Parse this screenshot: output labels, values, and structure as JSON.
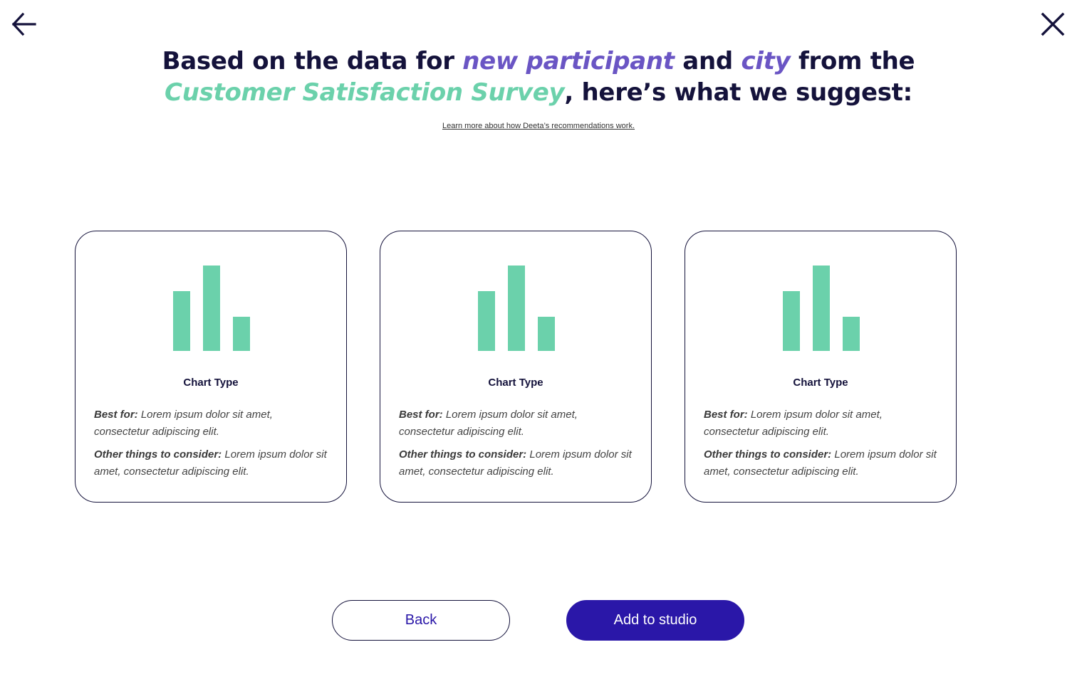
{
  "nav": {
    "back_icon": "arrow-left-icon",
    "close_icon": "close-icon"
  },
  "headline": {
    "part1": "Based on the data for ",
    "highlight1": "new participant",
    "part2": " and ",
    "highlight2": "city",
    "part3": " from the",
    "highlight3": "Customer Satisfaction Survey",
    "part4": ", here’s what we suggest:"
  },
  "learn_more": "Learn more about how Deeta’s recommendations work.",
  "cards": [
    {
      "title": "Chart Type",
      "best_label": "Best for:",
      "best_text": " Lorem ipsum dolor sit amet, consectetur adipiscing elit.",
      "other_label": "Other things to consider:",
      "other_text": " Lorem ipsum dolor sit amet, consectetur adipiscing elit."
    },
    {
      "title": "Chart Type",
      "best_label": "Best for:",
      "best_text": " Lorem ipsum dolor sit amet, consectetur adipiscing elit.",
      "other_label": "Other things to consider:",
      "other_text": " Lorem ipsum dolor sit amet, consectetur adipiscing elit."
    },
    {
      "title": "Chart Type",
      "best_label": "Best for:",
      "best_text": " Lorem ipsum dolor sit amet, consectetur adipiscing elit.",
      "other_label": "Other things to consider:",
      "other_text": " Lorem ipsum dolor sit amet, consectetur adipiscing elit."
    }
  ],
  "buttons": {
    "back_label": "Back",
    "add_label": "Add to studio"
  },
  "colors": {
    "primary": "#2a17a8",
    "text_dark": "#14123b",
    "accent_purple": "#6a55c4",
    "accent_green": "#6bd1ab"
  }
}
